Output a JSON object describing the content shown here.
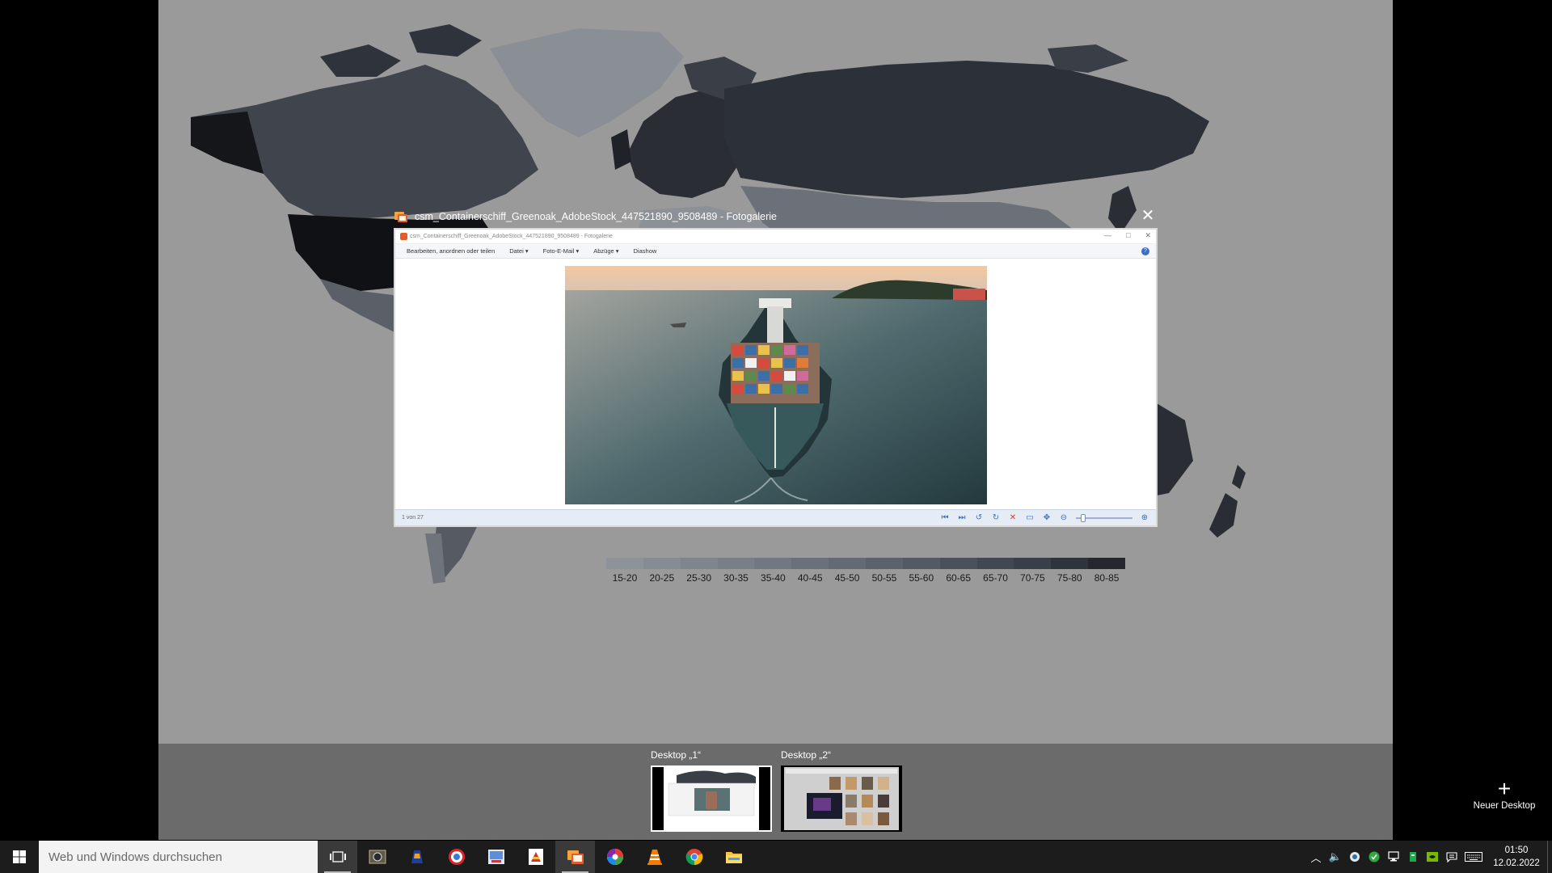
{
  "window": {
    "title": "csm_Containerschiff_Greenoak_AdobeStock_447521890_9508489 - Fotogalerie",
    "close_glyph": "✕"
  },
  "app": {
    "title_small": "csm_Containerschiff_Greenoak_AdobeStock_447521890_9508489 - Fotogalerie",
    "menu": [
      {
        "label": "Bearbeiten, anordnen oder teilen"
      },
      {
        "label": "Datei ▾"
      },
      {
        "label": "Foto-E-Mail ▾"
      },
      {
        "label": "Abzüge ▾"
      },
      {
        "label": "Diashow"
      }
    ],
    "help": "?",
    "status_count": "1 von 27",
    "controls": [
      "previous-icon",
      "next-icon",
      "rotate-left-icon",
      "rotate-right-icon",
      "delete-icon",
      "slideshow-icon",
      "actual-size-icon",
      "zoom-out-icon",
      "zoom-in-icon"
    ]
  },
  "legend": {
    "labels": [
      "15-20",
      "20-25",
      "25-30",
      "30-35",
      "35-40",
      "40-45",
      "45-50",
      "50-55",
      "55-60",
      "60-65",
      "65-70",
      "70-75",
      "75-80",
      "80-85"
    ],
    "colors": [
      "#8e9299",
      "#878b93",
      "#80848d",
      "#797e87",
      "#727781",
      "#6b707b",
      "#646a75",
      "#5c626d",
      "#545a65",
      "#4b515c",
      "#424852",
      "#393e48",
      "#2f333c",
      "#24272e"
    ]
  },
  "desktops": [
    {
      "label": "Desktop „1“"
    },
    {
      "label": "Desktop „2“"
    }
  ],
  "new_desktop": {
    "plus": "+",
    "label": "Neuer Desktop"
  },
  "taskbar": {
    "search_placeholder": "Web und Windows durchsuchen",
    "apps": [
      "task-view-icon",
      "photo-viewer-icon",
      "vlc-alt-icon",
      "opera-icon",
      "image-editor-icon",
      "pdf-icon",
      "photo-gallery-icon",
      "picasa-icon",
      "vlc-icon",
      "chrome-icon",
      "file-explorer-icon"
    ],
    "time": "01:50",
    "date": "12.02.2022"
  }
}
